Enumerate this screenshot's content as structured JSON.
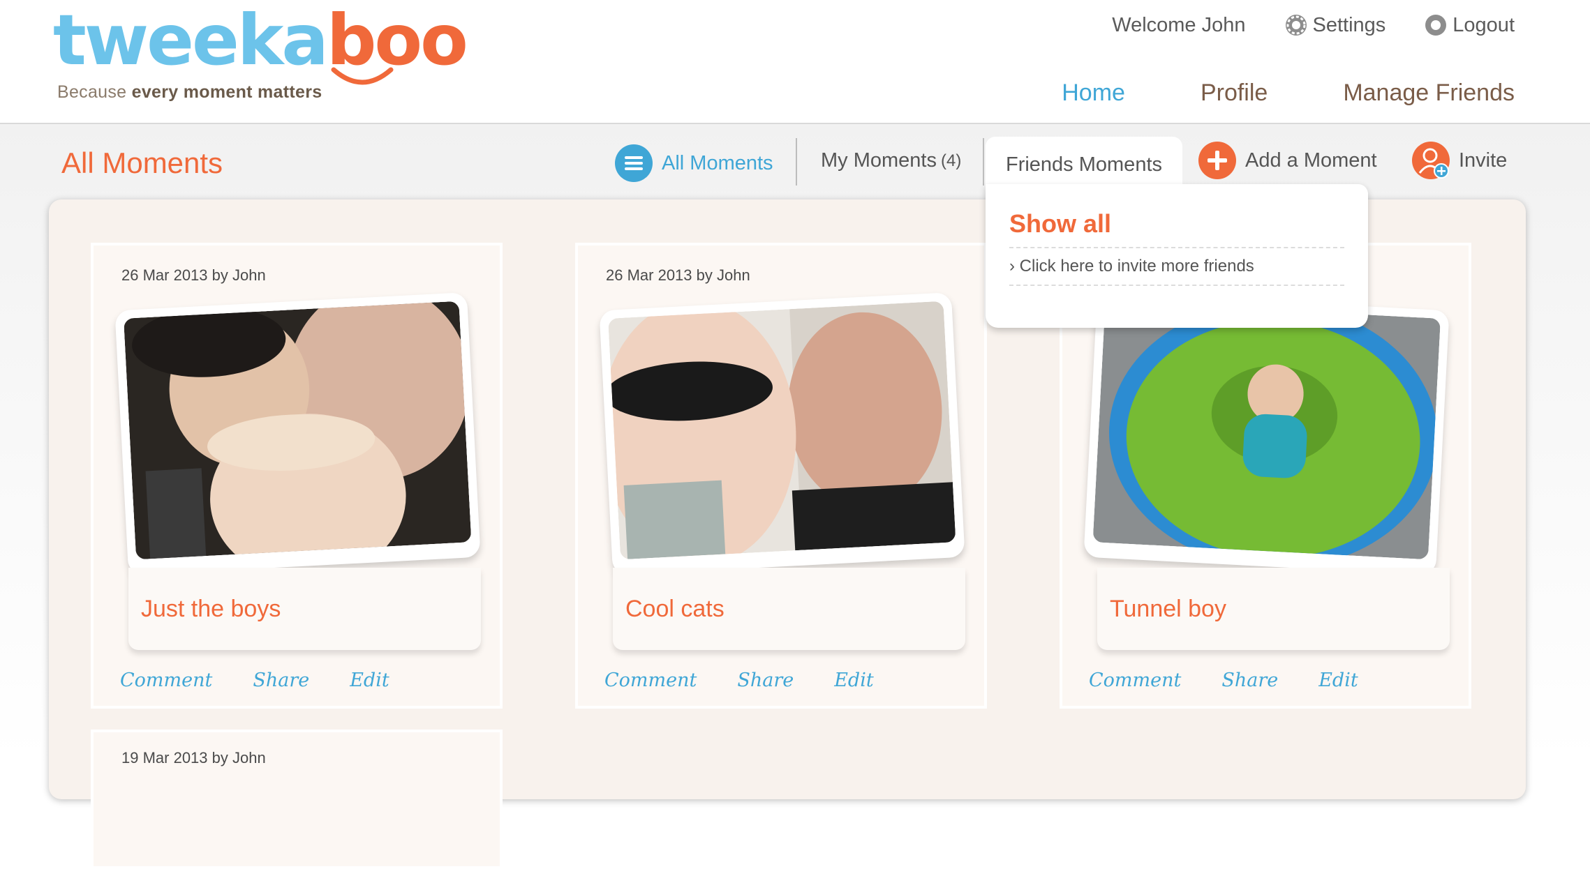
{
  "brand": {
    "logo_main": "tweeka",
    "logo_accent": "boo",
    "tagline_start": "Because ",
    "tagline_bold": "every moment matters"
  },
  "topbar": {
    "welcome": "Welcome John",
    "settings": "Settings",
    "logout": "Logout"
  },
  "nav": {
    "home": "Home",
    "profile": "Profile",
    "manage_friends": "Manage Friends"
  },
  "subheader": {
    "title": "All Moments",
    "tabs": {
      "all": "All Moments",
      "my": "My Moments",
      "my_count": "(4)",
      "friends": "Friends Moments",
      "add": "Add a Moment",
      "invite": "Invite"
    }
  },
  "dropdown": {
    "show_all": "Show all",
    "invite_link": "› Click here to invite more friends"
  },
  "moments": [
    {
      "date": "26 Mar 2013 by John",
      "caption": "Just the boys",
      "comment": "Comment",
      "share": "Share",
      "edit": "Edit"
    },
    {
      "date": "26 Mar 2013 by John",
      "caption": "Cool cats",
      "comment": "Comment",
      "share": "Share",
      "edit": "Edit"
    },
    {
      "date": "",
      "caption": "Tunnel boy",
      "comment": "Comment",
      "share": "Share",
      "edit": "Edit"
    },
    {
      "date": "19 Mar 2013 by John"
    }
  ],
  "colors": {
    "accent_orange": "#f0693a",
    "accent_blue": "#3fa6d6",
    "brown": "#7a5c48"
  }
}
